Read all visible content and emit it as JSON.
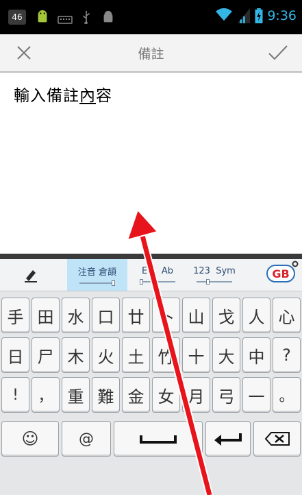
{
  "status_bar": {
    "time": "9:36",
    "icons": [
      "badge-46-icon",
      "android-icon",
      "keyboard-icon",
      "usb-icon",
      "android-debug-icon",
      "wifi-icon",
      "signal-icon",
      "battery-icon"
    ],
    "notif_badge": "46"
  },
  "title_bar": {
    "title": "備註",
    "cancel_icon": "close-icon",
    "confirm_icon": "check-icon"
  },
  "editor": {
    "text_before": "輸入備註",
    "underlined_char": "內",
    "text_after": "容"
  },
  "keyboard": {
    "mode_row": {
      "pen_icon": "pen-icon",
      "zhuyin_label": "注音 倉頡",
      "en_label": "En",
      "ab_label": "Ab",
      "num_label": "123",
      "sym_label": "Sym",
      "gb_label": "GB"
    },
    "rows": [
      [
        "手",
        "田",
        "水",
        "口",
        "廿",
        "卜",
        "山",
        "戈",
        "人",
        "心"
      ],
      [
        "日",
        "尸",
        "木",
        "火",
        "土",
        "竹",
        "十",
        "大",
        "中",
        "?"
      ],
      [
        "!",
        "，",
        "重",
        "難",
        "金",
        "女",
        "月",
        "弓",
        "一",
        "。"
      ]
    ],
    "bottom": {
      "smiley": "☺",
      "at": "@"
    }
  },
  "colors": {
    "status_accent": "#33b5e5",
    "arrow": "#e8141c",
    "active_mode": "#bfe3f7"
  }
}
